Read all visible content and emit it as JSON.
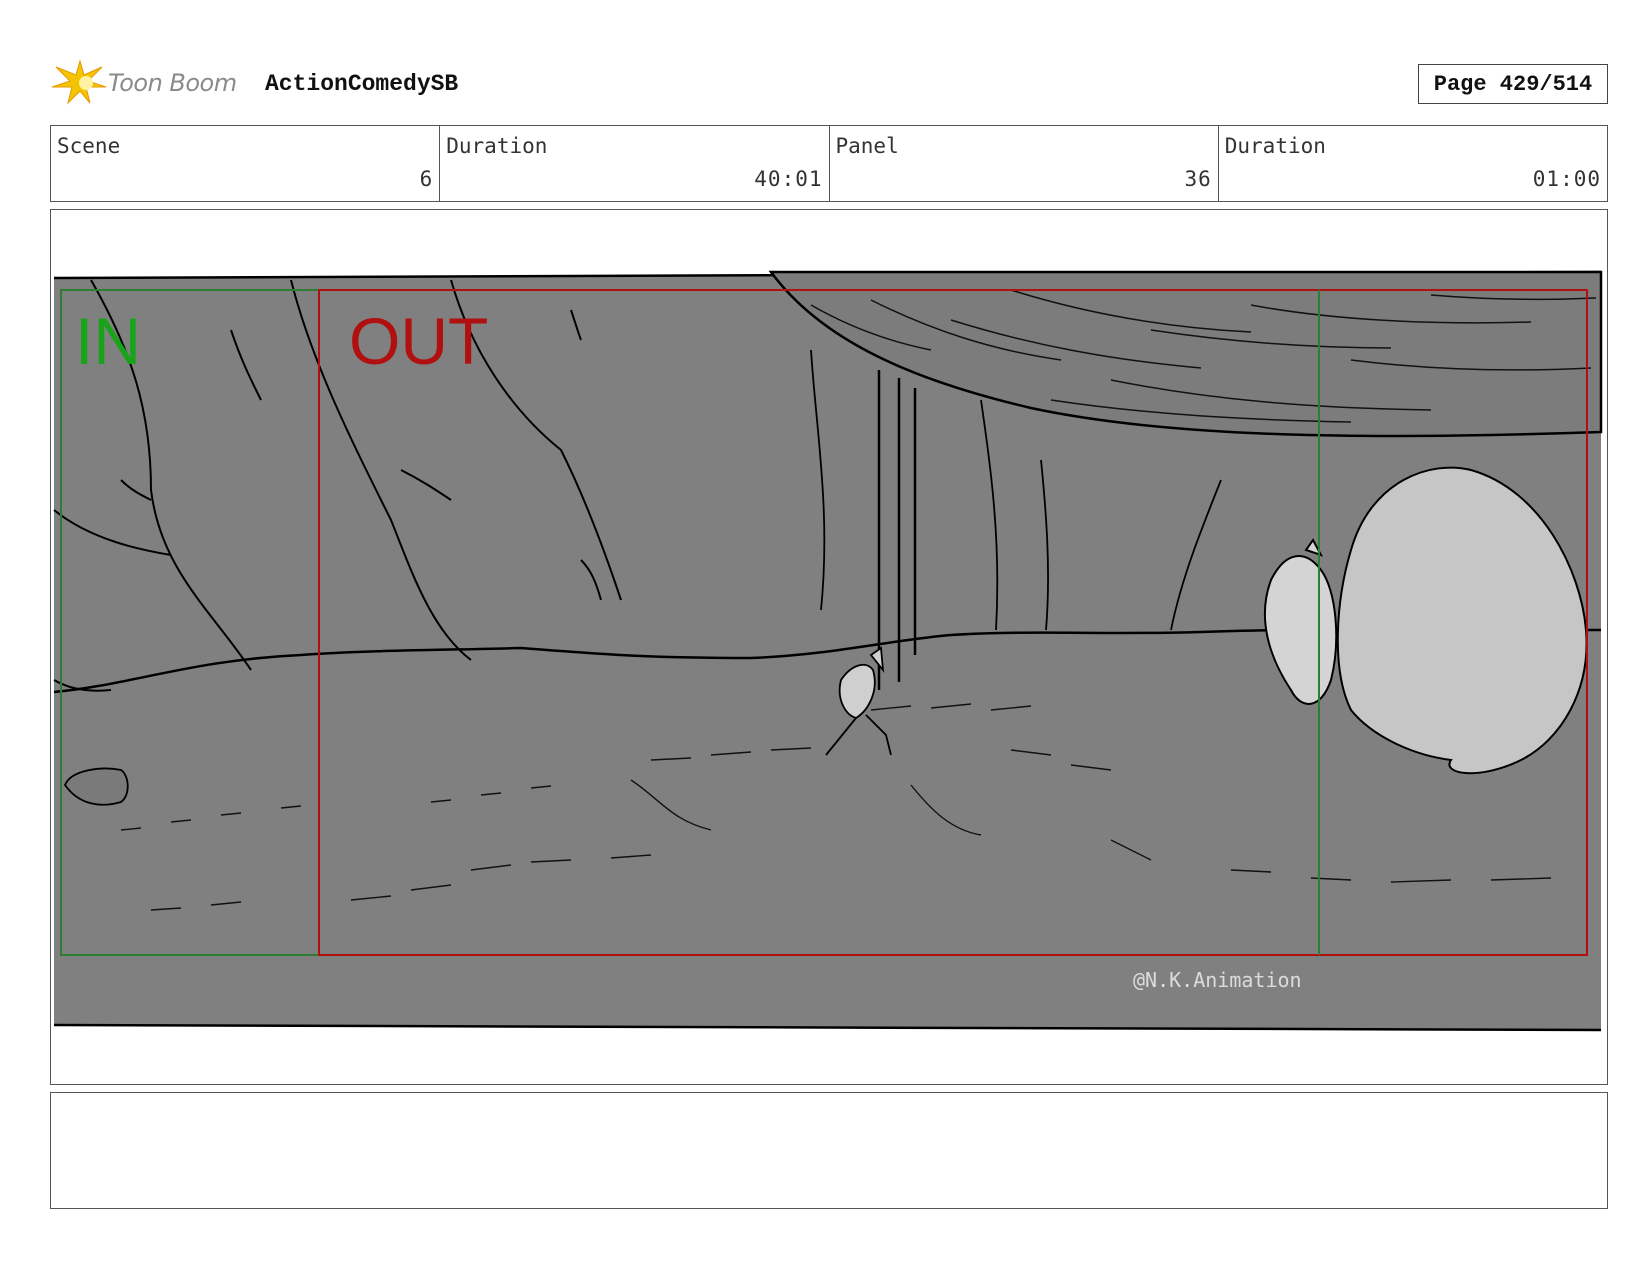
{
  "header": {
    "brand": "Toon Boom",
    "project": "ActionComedySB",
    "page_label": "Page 429/514"
  },
  "info": [
    {
      "label": "Scene",
      "value": "6"
    },
    {
      "label": "Duration",
      "value": "40:01"
    },
    {
      "label": "Panel",
      "value": "36"
    },
    {
      "label": "Duration",
      "value": "01:00"
    }
  ],
  "panel": {
    "in_label": "IN",
    "out_label": "OUT",
    "watermark": "@N.K.Animation"
  },
  "notes": {
    "text": ""
  },
  "colors": {
    "in_frame": "#2e7d32",
    "out_frame": "#b01010",
    "background": "#808080",
    "logo_yellow": "#f5c400"
  }
}
